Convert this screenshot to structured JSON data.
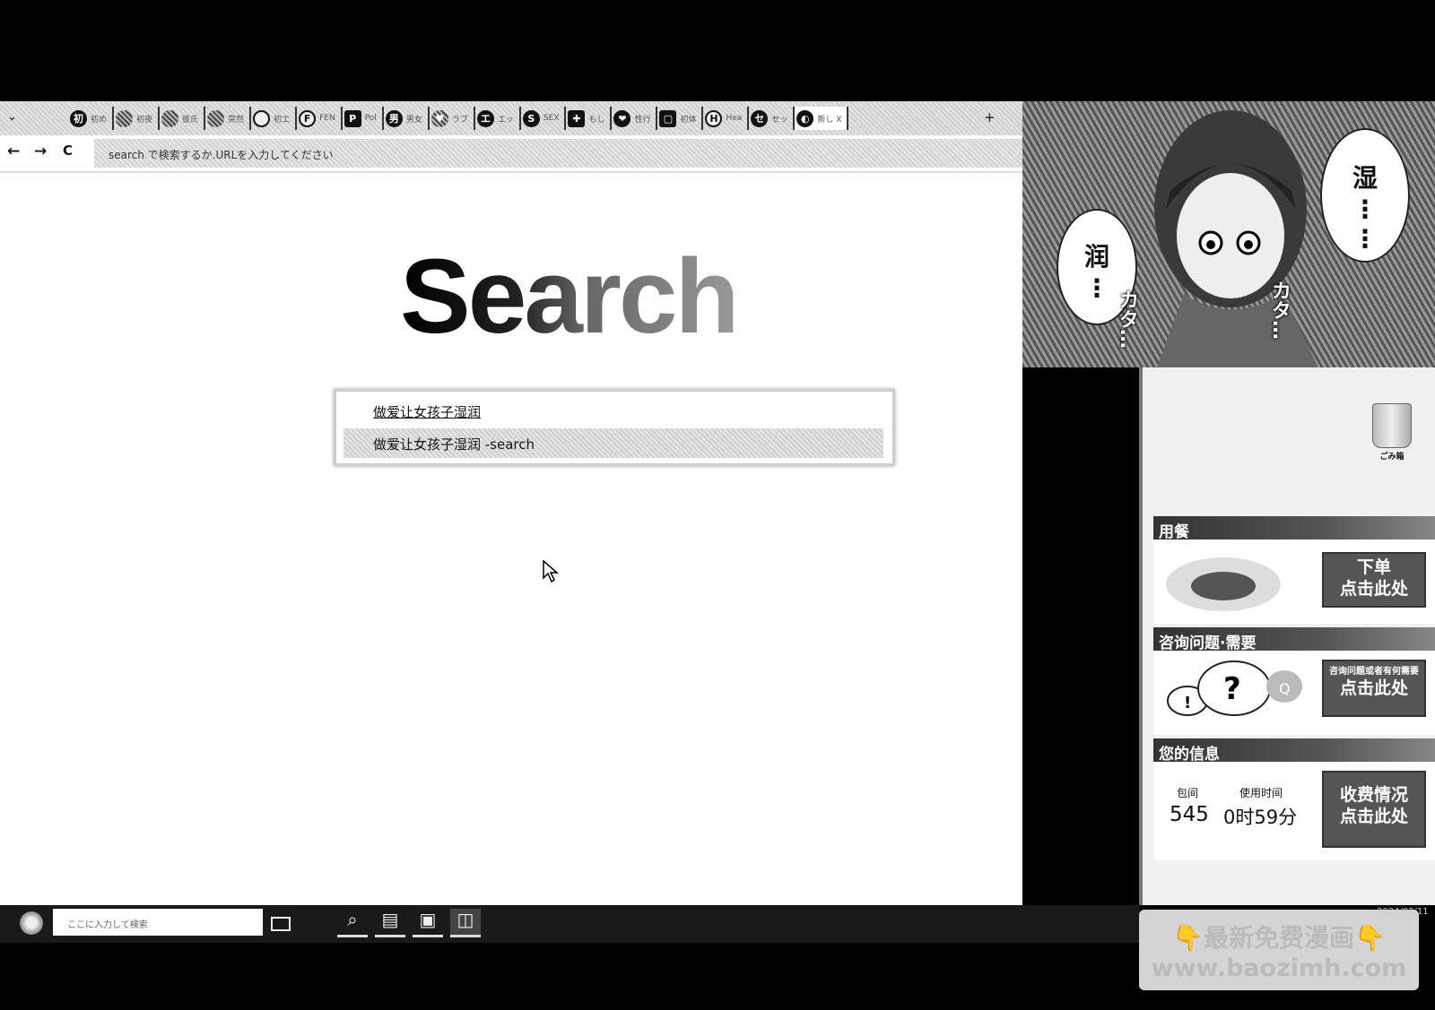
{
  "browser": {
    "tabs": [
      {
        "icon": "初",
        "label": "初め",
        "style": ""
      },
      {
        "icon": "",
        "label": "初夜",
        "style": "dots"
      },
      {
        "icon": "",
        "label": "彼氏",
        "style": "dots"
      },
      {
        "icon": "",
        "label": "突然",
        "style": "dots"
      },
      {
        "icon": "",
        "label": "初エ",
        "style": "outline"
      },
      {
        "icon": "F",
        "label": "FEN",
        "style": "outline"
      },
      {
        "icon": "P",
        "label": "Pol",
        "style": "sq"
      },
      {
        "icon": "男",
        "label": "男女",
        "style": ""
      },
      {
        "icon": "♥",
        "label": "ラブ",
        "style": "dots"
      },
      {
        "icon": "エ",
        "label": "エッ",
        "style": ""
      },
      {
        "icon": "S",
        "label": "SEX",
        "style": ""
      },
      {
        "icon": "✚",
        "label": "もし",
        "style": "sq"
      },
      {
        "icon": "❤",
        "label": "性行",
        "style": ""
      },
      {
        "icon": "▢",
        "label": "初体",
        "style": "sq"
      },
      {
        "icon": "H",
        "label": "Hea",
        "style": "outline"
      },
      {
        "icon": "セ",
        "label": "セッ",
        "style": ""
      },
      {
        "icon": "◐",
        "label": "新し X",
        "style": "",
        "active": true
      }
    ],
    "new_tab": "+",
    "tab_list": "⌄",
    "nav": {
      "back": "←",
      "forward": "→",
      "reload": "C"
    },
    "address_placeholder": "search で検索するか.URLを入力してください"
  },
  "page": {
    "logo": "Search",
    "suggestions": {
      "query": "做爱让女孩子湿润",
      "row_text": "做爱让女孩子湿润  -search"
    }
  },
  "manga": {
    "bubble_left": [
      "润",
      "⋮"
    ],
    "bubble_right": [
      "湿",
      "⋮",
      "⋮"
    ],
    "sfx_left": "カタ…",
    "sfx_right": "カタ…"
  },
  "side_panel": {
    "trash_label": "ごみ箱",
    "dining": {
      "title": "用餐",
      "btn_line1": "下单",
      "btn_line2": "点击此处"
    },
    "inquiry": {
      "title": "咨询问题·需要",
      "btn_line1": "咨询问题或者有何需要",
      "btn_line2": "点击此处"
    },
    "info": {
      "title": "您的信息",
      "room_label": "包间",
      "room_value": "545",
      "time_label": "使用时间",
      "time_value": "0时59分",
      "btn_line1": "收费情况",
      "btn_line2": "点击此处"
    }
  },
  "taskbar": {
    "search_placeholder": "ここに入力して検索",
    "apps": [
      "⌕",
      "▤",
      "▣",
      "◫"
    ],
    "tray_date": "2024/02/11"
  },
  "watermark": {
    "line1": "👇最新免费漫画👇",
    "line2": "www.baozimh.com"
  }
}
